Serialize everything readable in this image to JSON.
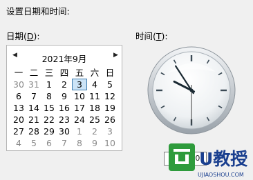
{
  "dialog": {
    "header": "设置日期和时间:",
    "date_label": "日期(",
    "date_key": "D",
    "date_label_end": "):",
    "time_label": "时间(",
    "time_key": "T",
    "time_label_end": "):"
  },
  "calendar": {
    "month_title": "2021年9月",
    "prev_icon": "◀",
    "next_icon": "▶",
    "weekdays": [
      "一",
      "二",
      "三",
      "四",
      "五",
      "六",
      "日"
    ],
    "weeks": [
      [
        {
          "d": "30",
          "g": true
        },
        {
          "d": "31",
          "g": true
        },
        {
          "d": "1"
        },
        {
          "d": "2"
        },
        {
          "d": "3",
          "sel": true
        },
        {
          "d": "4"
        },
        {
          "d": "5"
        }
      ],
      [
        {
          "d": "6"
        },
        {
          "d": "7"
        },
        {
          "d": "8"
        },
        {
          "d": "9"
        },
        {
          "d": "10"
        },
        {
          "d": "11"
        },
        {
          "d": "12"
        }
      ],
      [
        {
          "d": "13"
        },
        {
          "d": "14"
        },
        {
          "d": "15"
        },
        {
          "d": "16"
        },
        {
          "d": "17"
        },
        {
          "d": "18"
        },
        {
          "d": "19"
        }
      ],
      [
        {
          "d": "20"
        },
        {
          "d": "21"
        },
        {
          "d": "22"
        },
        {
          "d": "23"
        },
        {
          "d": "24"
        },
        {
          "d": "25"
        },
        {
          "d": "26"
        }
      ],
      [
        {
          "d": "27"
        },
        {
          "d": "28"
        },
        {
          "d": "29"
        },
        {
          "d": "30"
        },
        {
          "d": "1",
          "g": true
        },
        {
          "d": "2",
          "g": true
        },
        {
          "d": "3",
          "g": true
        }
      ],
      [
        {
          "d": "4",
          "g": true
        },
        {
          "d": "5",
          "g": true
        },
        {
          "d": "6",
          "g": true
        },
        {
          "d": "7",
          "g": true
        },
        {
          "d": "8",
          "g": true
        },
        {
          "d": "9",
          "g": true
        },
        {
          "d": "10",
          "g": true
        }
      ]
    ]
  },
  "clock": {
    "hour": 9,
    "minute": 54,
    "second": 30
  },
  "time_field": {
    "value": ":54:30"
  },
  "watermark": {
    "text": "U教授",
    "subtext": "UJIAOSHOU.COM",
    "color_green": "#2e9b3c",
    "color_blue": "#1a3f8f"
  }
}
